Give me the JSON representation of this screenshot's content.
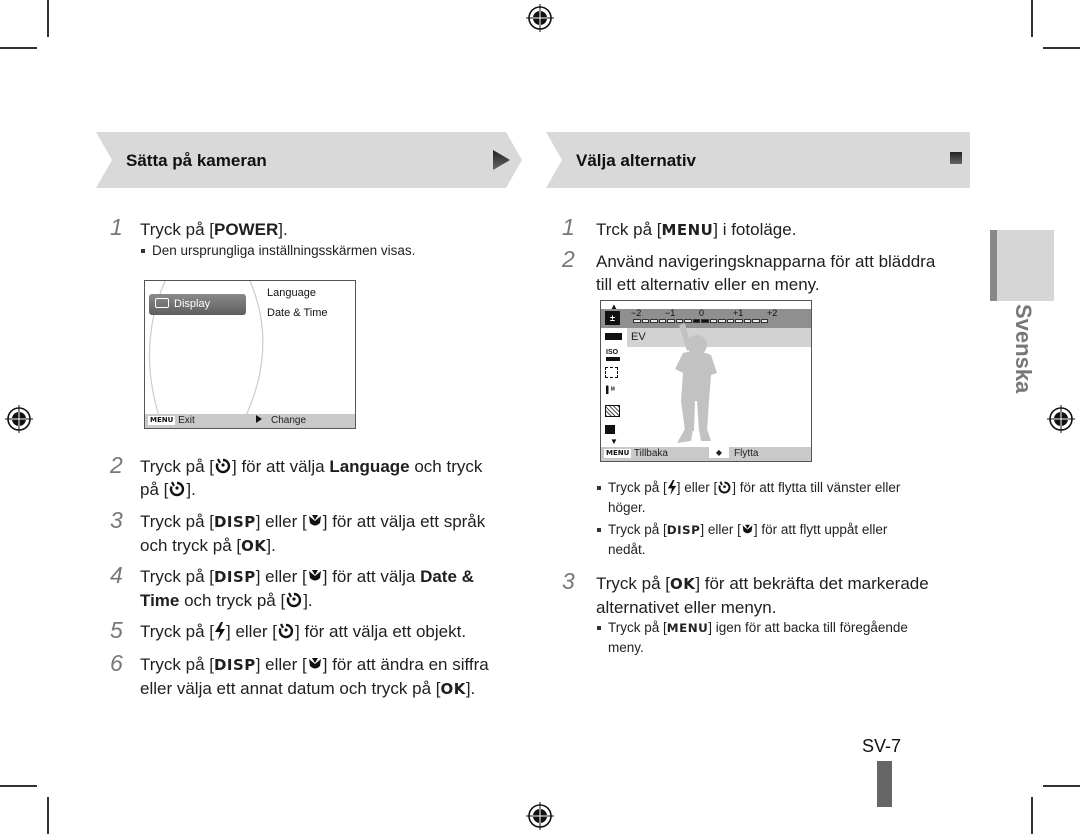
{
  "page": {
    "page_number": "SV-7",
    "language_tab": "Svenska"
  },
  "left_section": {
    "title": "Sätta på kameran",
    "steps": [
      {
        "num": "1",
        "parts": [
          "Tryck på [",
          "POWER",
          "]."
        ],
        "note": "Den ursprungliga inställningsskärmen visas."
      },
      {
        "num": "2",
        "line1_a": "Tryck på [",
        "line1_b": "] för att välja ",
        "line1_bold": "Language",
        "line1_c": " och tryck",
        "line2_a": "på [",
        "line2_b": "]."
      },
      {
        "num": "3",
        "line1_a": "Tryck på [",
        "line1_key": "DISP",
        "line1_b": "] eller [",
        "line1_c": "] för att välja ett språk",
        "line2_a": "och tryck på [",
        "line2_key": "OK",
        "line2_b": "]."
      },
      {
        "num": "4",
        "line1_a": "Tryck på [",
        "line1_key": "DISP",
        "line1_b": "] eller [",
        "line1_c": "] för att välja ",
        "line1_bold": "Date &",
        "line2_bold": "Time",
        "line2_a": " och tryck på [",
        "line2_b": "]."
      },
      {
        "num": "5",
        "line1_a": "Tryck på [",
        "line1_b": "] eller [",
        "line1_c": "] för att välja ett objekt."
      },
      {
        "num": "6",
        "line1_a": "Tryck på [",
        "line1_key": "DISP",
        "line1_b": "] eller [",
        "line1_c": "] för att ändra en siffra",
        "line2_a": "eller välja ett annat datum och tryck på [",
        "line2_key": "OK",
        "line2_b": "]."
      }
    ],
    "screen": {
      "selected_menu": "Display",
      "options": [
        "Language",
        "Date & Time"
      ],
      "bottom_left_key": "MENU",
      "bottom_left_label": "Exit",
      "bottom_right_label": "Change"
    }
  },
  "right_section": {
    "title": "Välja alternativ",
    "step1": {
      "num": "1",
      "a": "Trck på [",
      "key": "MENU",
      "b": "] i fotoläge."
    },
    "step2": {
      "num": "2",
      "line1": "Använd navigeringsknapparna för att bläddra",
      "line2": "till ett alternativ eller en meny."
    },
    "bullets": [
      {
        "line1_a": "Tryck på [",
        "line1_b": "] eller [",
        "line1_c": "] för att flytta till vänster eller",
        "line2": "höger."
      },
      {
        "line1_a": "Tryck på [",
        "line1_key": "DISP",
        "line1_b": "] eller [",
        "line1_c": "] för att flytt uppåt eller",
        "line2": "nedåt."
      }
    ],
    "step3": {
      "num": "3",
      "line1_a": "Tryck på [",
      "line1_key": "OK",
      "line1_b": "] för att bekräfta det markerade",
      "line2": "alternativet eller menyn."
    },
    "step3_bullet": {
      "a": "Tryck på [",
      "key": "MENU",
      "b": "] igen för att backa till föregående",
      "line2": "meny."
    },
    "screen": {
      "ev_ticks": [
        "−2",
        "−1",
        "0",
        "+1",
        "+2"
      ],
      "ev_value": 0,
      "selected_option": "EV",
      "side_icons": [
        "ev-icon",
        "wb-icon",
        "iso-icon",
        "face-detect-icon",
        "focus-area-icon",
        "metering-icon",
        "smart-range-icon"
      ],
      "bottom_left_key": "MENU",
      "bottom_left_label": "Tillbaka",
      "bottom_right_label": "Flytta"
    }
  },
  "colors": {
    "header_bg": "#d9d9d9",
    "tab_dark": "#888888",
    "tab_light": "#d6d6d6",
    "step_number": "#777777",
    "page_bar": "#666666"
  }
}
